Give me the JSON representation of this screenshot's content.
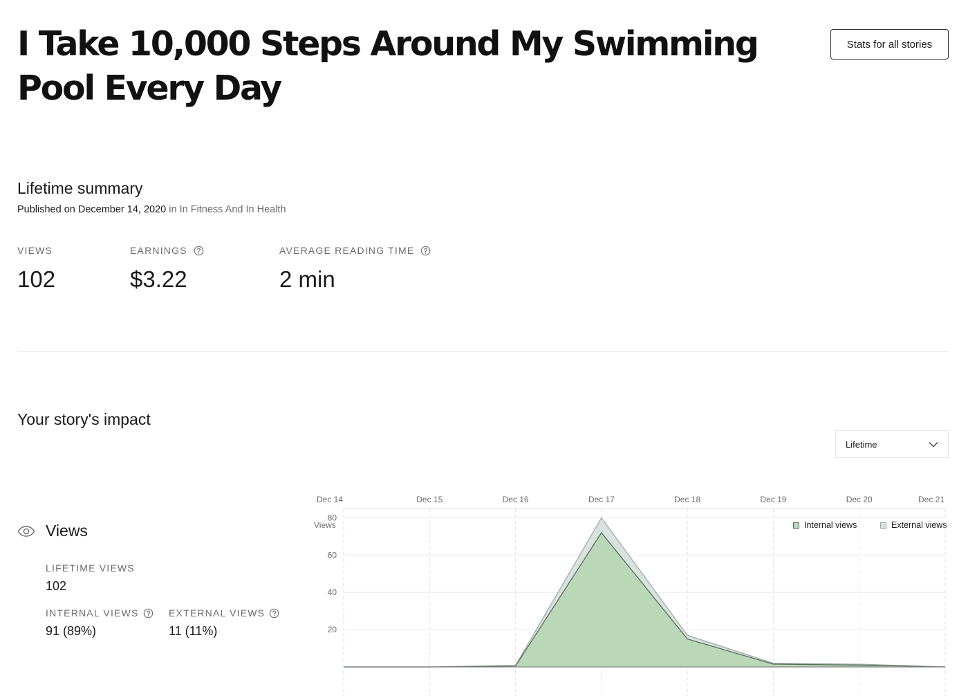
{
  "story": {
    "title": "I Take 10,000 Steps Around My Swimming Pool Every Day",
    "stats_all_label": "Stats for all stories"
  },
  "summary": {
    "heading": "Lifetime summary",
    "published_prefix": "Published on December 14, 2020",
    "publication_link": "in In Fitness And In Health",
    "stats": [
      {
        "label": "VIEWS",
        "value": "102",
        "help": false
      },
      {
        "label": "EARNINGS",
        "value": "$3.22",
        "help": true
      },
      {
        "label": "AVERAGE READING TIME",
        "value": "2 min",
        "help": true
      }
    ]
  },
  "impact": {
    "heading": "Your story's impact",
    "range_selected": "Lifetime",
    "views_title": "Views",
    "lifetime_views_label": "LIFETIME VIEWS",
    "lifetime_views_value": "102",
    "internal_views_label": "INTERNAL VIEWS",
    "internal_views_value": "91 (89%)",
    "external_views_label": "EXTERNAL VIEWS",
    "external_views_value": "11 (11%)"
  },
  "colors": {
    "internal_fill": "#bad8b8",
    "internal_line": "#5c6b5c",
    "external_fill": "#d8e3e0",
    "external_line": "#9aa7a4",
    "text_muted": "#6b6b6b"
  },
  "chart_data": {
    "type": "area",
    "x": [
      "Dec 14",
      "Dec 15",
      "Dec 16",
      "Dec 17",
      "Dec 18",
      "Dec 19",
      "Dec 20",
      "Dec 21"
    ],
    "ylabel": "Views",
    "yticks": [
      20,
      40,
      60,
      80
    ],
    "ylim": [
      0,
      85
    ],
    "grid": true,
    "legend_position": "top-right",
    "series": [
      {
        "name": "Internal views",
        "values": [
          0,
          0,
          0.5,
          72,
          15,
          1.5,
          1,
          0
        ]
      },
      {
        "name": "External views",
        "values": [
          0,
          0,
          0.3,
          8,
          2,
          0.5,
          0.5,
          0
        ]
      }
    ]
  }
}
